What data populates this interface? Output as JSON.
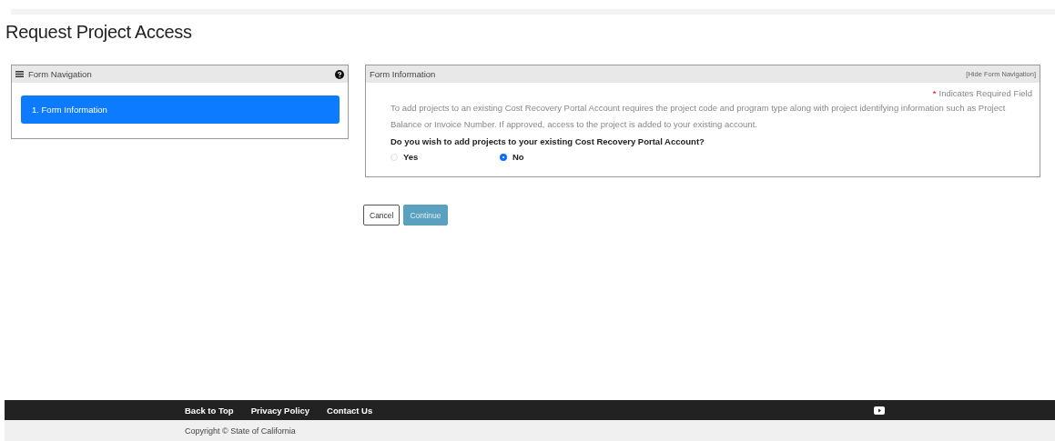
{
  "page": {
    "title": "Request Project Access"
  },
  "form_navigation": {
    "title": "Form Navigation",
    "items": [
      {
        "label": "1. Form Information",
        "selected": true
      }
    ]
  },
  "form_information": {
    "title": "Form Information",
    "hide_link": "[Hide Form Navigation]",
    "required_marker": "*",
    "required_note": "Indicates Required Field",
    "description": "To add projects to an existing Cost Recovery Portal Account requires the project code and program type along with project identifying information such as Project Balance or Invoice Number. If approved, access to the project is added to your existing account.",
    "question": "Do you wish to add projects to your existing Cost Recovery Portal Account?",
    "options": [
      {
        "label": "Yes",
        "selected": false
      },
      {
        "label": "No",
        "selected": true
      }
    ]
  },
  "buttons": [
    {
      "label": "Cancel",
      "kind": "secondary"
    },
    {
      "label": "Continue",
      "kind": "primary"
    }
  ],
  "footer": {
    "links": [
      "Back to Top",
      "Privacy Policy",
      "Contact Us"
    ],
    "copyright": "Copyright © State of California"
  }
}
